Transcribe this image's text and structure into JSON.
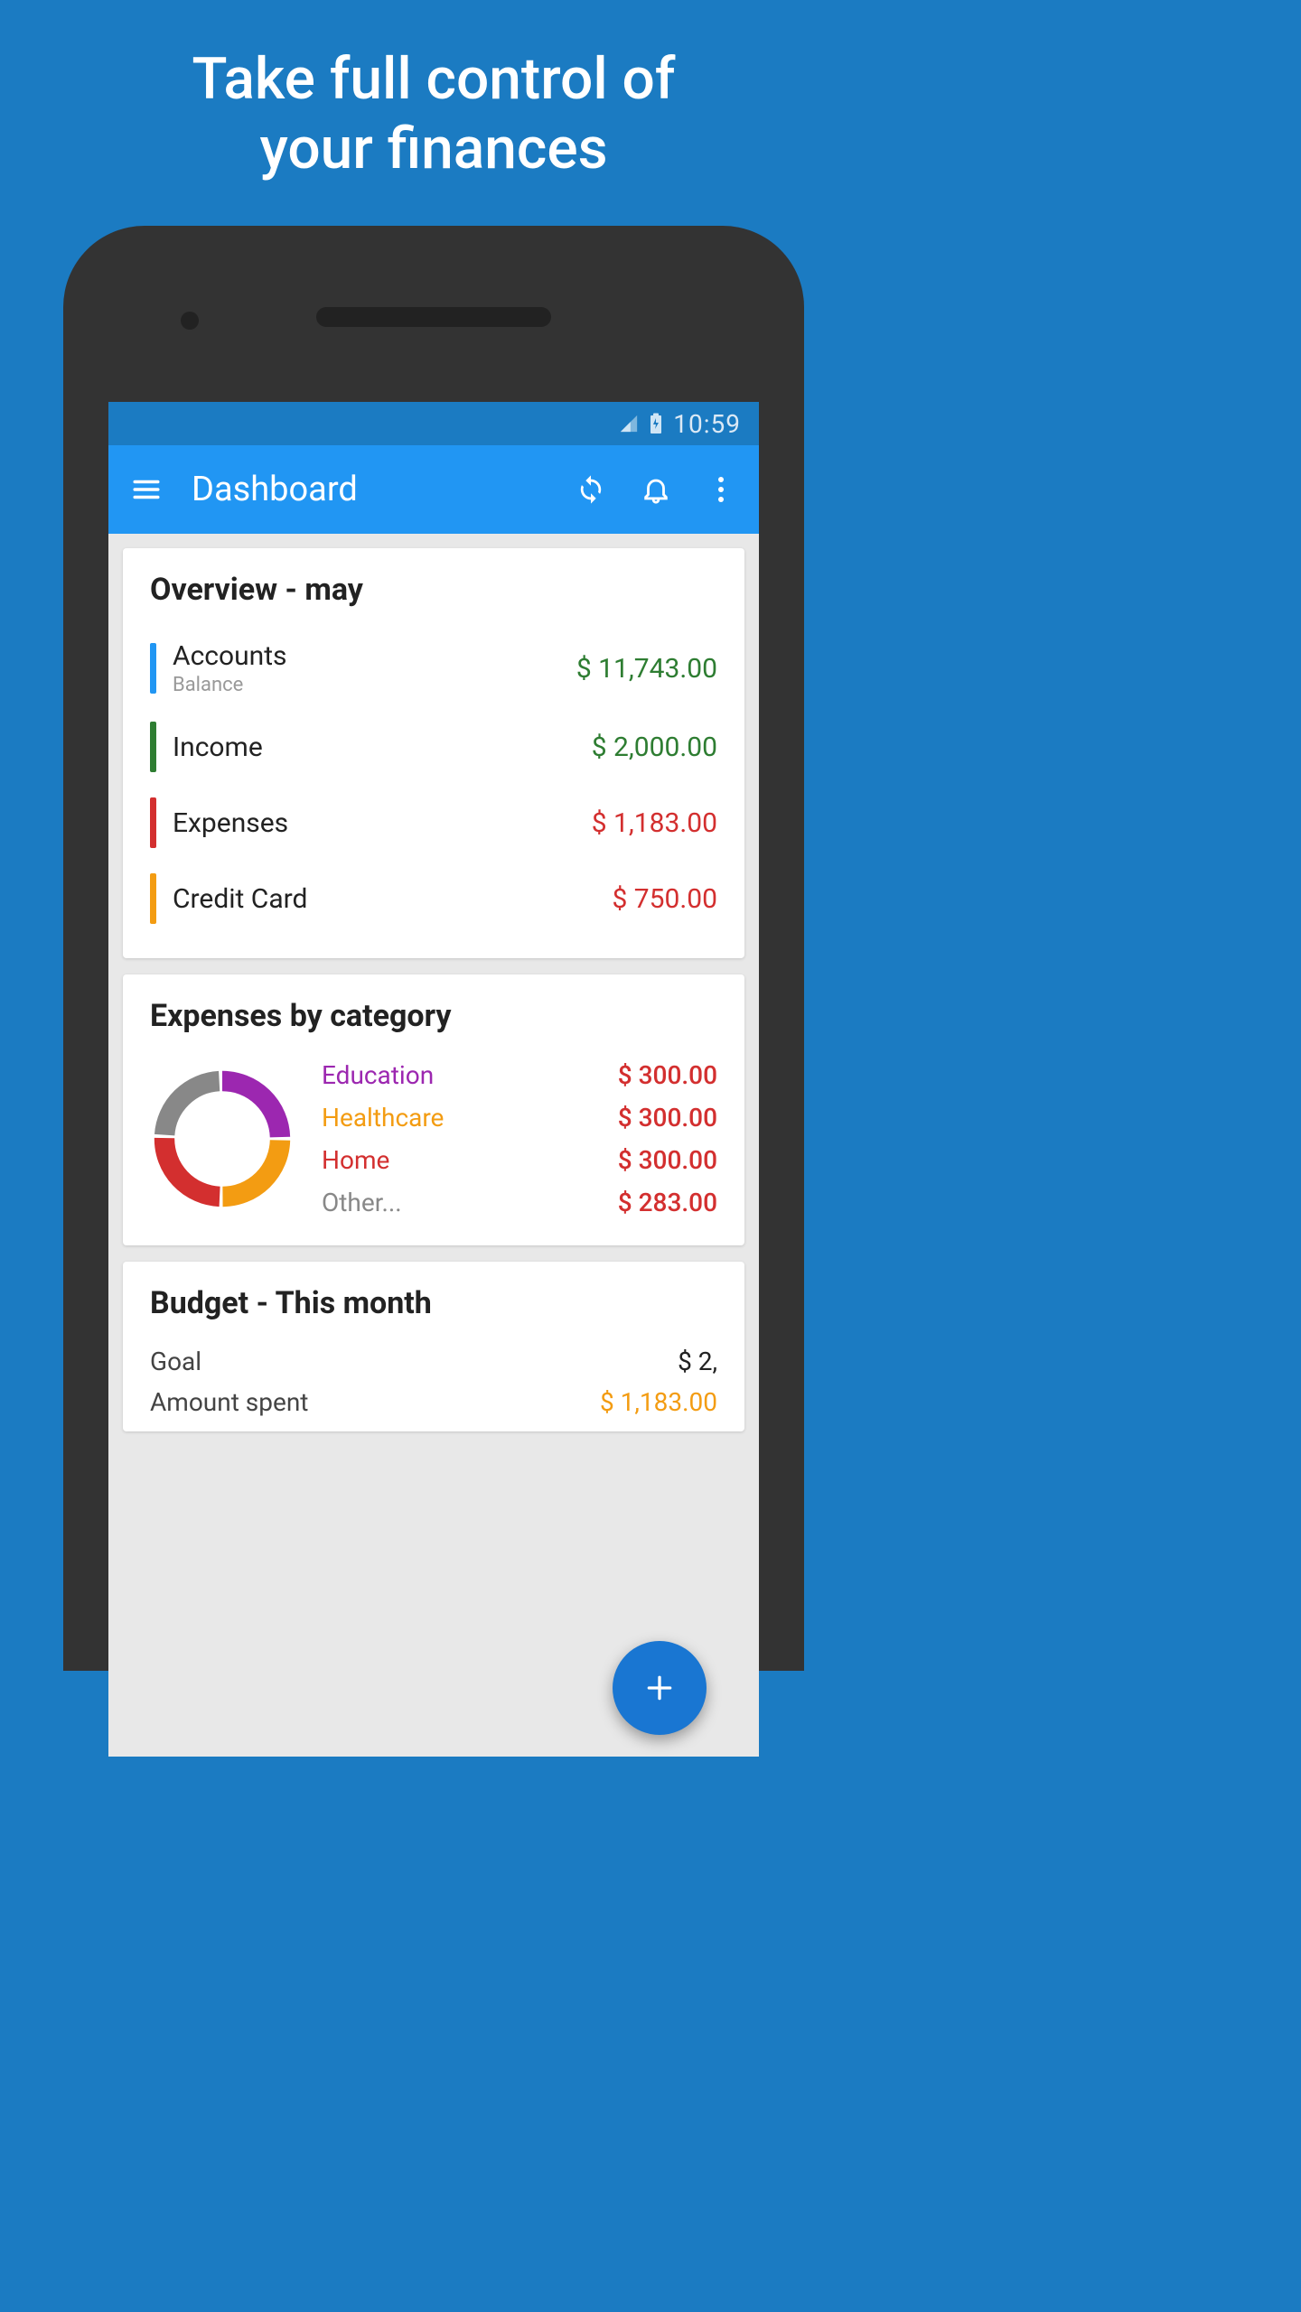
{
  "hero": {
    "line1": "Take full control of",
    "line2": "your finances"
  },
  "status": {
    "time": "10:59"
  },
  "appbar": {
    "title": "Dashboard"
  },
  "overview": {
    "title": "Overview - may",
    "items": [
      {
        "label": "Accounts",
        "sub": "Balance",
        "amount": "$ 11,743.00",
        "bar_color": "#2196f3",
        "amount_color": "#2e7d32"
      },
      {
        "label": "Income",
        "sub": "",
        "amount": "$ 2,000.00",
        "bar_color": "#2e7d32",
        "amount_color": "#2e7d32"
      },
      {
        "label": "Expenses",
        "sub": "",
        "amount": "$ 1,183.00",
        "bar_color": "#d32f2f",
        "amount_color": "#d32f2f"
      },
      {
        "label": "Credit Card",
        "sub": "",
        "amount": "$ 750.00",
        "bar_color": "#f39c12",
        "amount_color": "#d32f2f"
      }
    ]
  },
  "expenses": {
    "title": "Expenses by category",
    "rows": [
      {
        "label": "Education",
        "amount": "$ 300.00",
        "label_color": "#9c27b0"
      },
      {
        "label": "Healthcare",
        "amount": "$ 300.00",
        "label_color": "#f39c12"
      },
      {
        "label": "Home",
        "amount": "$ 300.00",
        "label_color": "#d32f2f"
      },
      {
        "label": "Other...",
        "amount": "$ 283.00",
        "label_color": "#888"
      }
    ]
  },
  "budget": {
    "title": "Budget - This month",
    "rows": [
      {
        "label": "Goal",
        "amount": "$ 2,",
        "amount_color": "#222"
      },
      {
        "label": "Amount spent",
        "amount": "$ 1,183.00",
        "amount_color": "#f39c12"
      }
    ]
  },
  "chart_data": {
    "type": "pie",
    "title": "Expenses by category",
    "categories": [
      "Education",
      "Healthcare",
      "Home",
      "Other"
    ],
    "values": [
      300,
      300,
      300,
      283
    ],
    "colors": [
      "#9c27b0",
      "#f39c12",
      "#d32f2f",
      "#888"
    ]
  }
}
